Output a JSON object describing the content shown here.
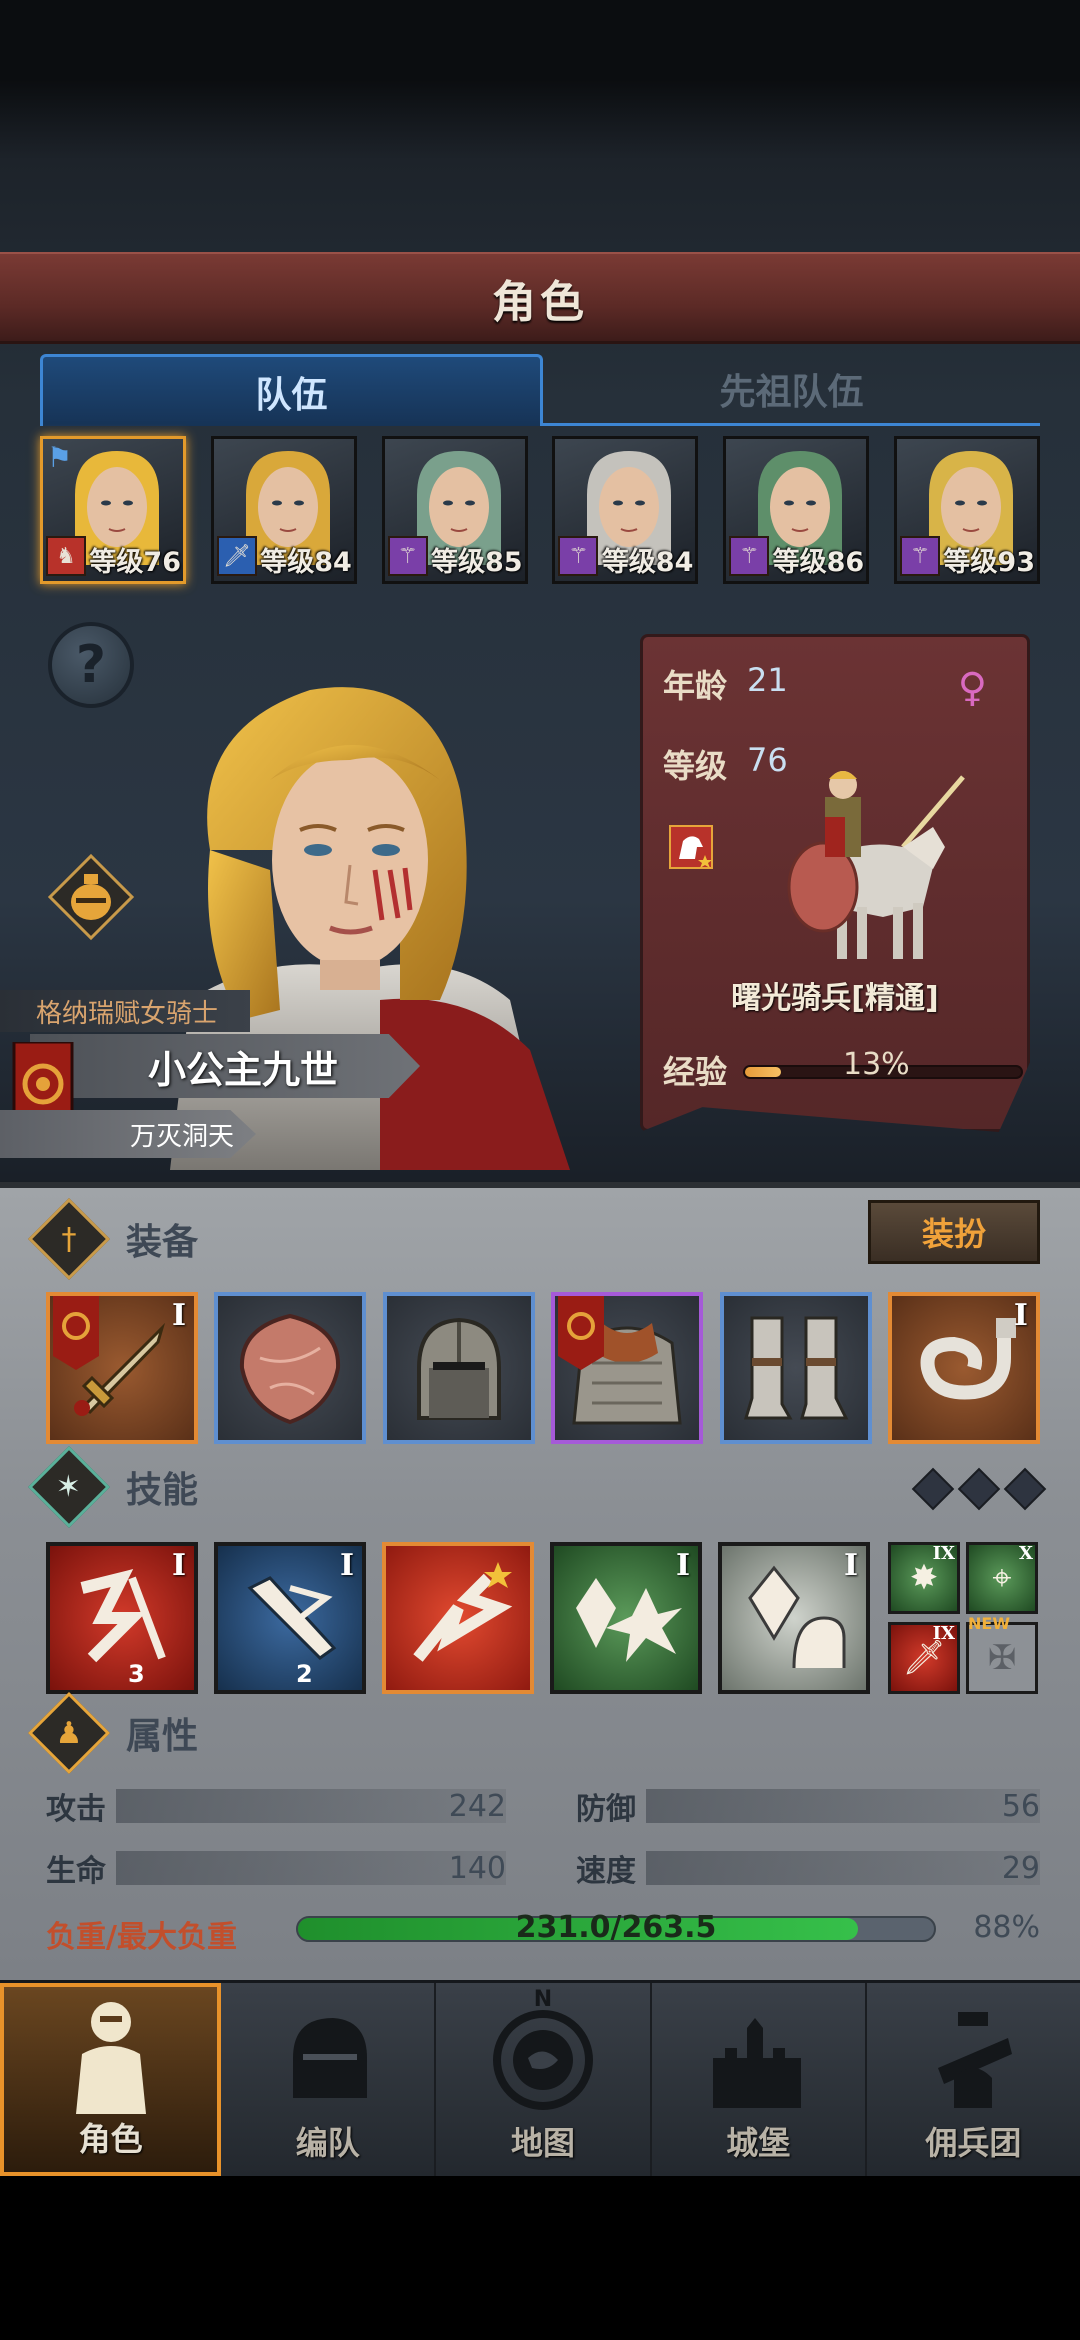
{
  "header": {
    "title": "角色"
  },
  "tabs": [
    {
      "label": "队伍",
      "active": true
    },
    {
      "label": "先祖队伍",
      "active": false
    }
  ],
  "roster": [
    {
      "level": "等级76",
      "class_icon": "horse-icon",
      "class_color": "#b8322a",
      "selected": true
    },
    {
      "level": "等级84",
      "class_icon": "sword-icon",
      "class_color": "#2b5fb0",
      "selected": false
    },
    {
      "level": "等级85",
      "class_icon": "staff-icon",
      "class_color": "#7a3fa8",
      "selected": false
    },
    {
      "level": "等级84",
      "class_icon": "staff-icon",
      "class_color": "#7a3fa8",
      "selected": false
    },
    {
      "level": "等级86",
      "class_icon": "staff-icon",
      "class_color": "#7a3fa8",
      "selected": false
    },
    {
      "level": "等级93",
      "class_icon": "staff-icon",
      "class_color": "#7a3fa8",
      "selected": false
    }
  ],
  "character": {
    "class_name": "格纳瑞赋女骑士",
    "name": "小公主九世",
    "title": "万灭洞天"
  },
  "info": {
    "age_label": "年龄",
    "age": "21",
    "level_label": "等级",
    "level": "76",
    "mount_name": "曙光骑兵[精通]",
    "exp_label": "经验",
    "exp_percent": "13%",
    "exp_fraction": 0.13
  },
  "equipment": {
    "title": "装备",
    "dress_button": "装扮",
    "items": [
      {
        "icon": "sword-icon",
        "tier": "I",
        "rarity": "orange"
      },
      {
        "icon": "shield-icon",
        "tier": "",
        "rarity": "blue"
      },
      {
        "icon": "helmet-icon",
        "tier": "",
        "rarity": "blue"
      },
      {
        "icon": "armor-icon",
        "tier": "",
        "rarity": "purple"
      },
      {
        "icon": "boots-icon",
        "tier": "",
        "rarity": "blue"
      },
      {
        "icon": "horn-icon",
        "tier": "I",
        "rarity": "orange"
      }
    ]
  },
  "skills": {
    "title": "技能",
    "items": [
      {
        "icon": "slash-skill-icon",
        "tier": "I",
        "level": "3",
        "color": "red"
      },
      {
        "icon": "strike-skill-icon",
        "tier": "I",
        "level": "2",
        "color": "blue"
      },
      {
        "icon": "charge-skill-icon",
        "tier": "",
        "level": "",
        "color": "orange"
      },
      {
        "icon": "crystal-burst-skill-icon",
        "tier": "I",
        "level": "",
        "color": "green"
      },
      {
        "icon": "crystal-shield-skill-icon",
        "tier": "I",
        "level": "",
        "color": "white"
      }
    ],
    "passives": [
      {
        "icon": "burst-passive-icon",
        "tier": "IX"
      },
      {
        "icon": "target-passive-icon",
        "tier": "X"
      },
      {
        "icon": "sword-passive-icon",
        "tier": "IX"
      },
      {
        "icon": "cross-passive-icon",
        "tier": ""
      }
    ],
    "new_tag": "NEW"
  },
  "attributes": {
    "title": "属性",
    "attack_label": "攻击",
    "attack": "242",
    "defense_label": "防御",
    "defense": "56",
    "hp_label": "生命",
    "hp": "140",
    "speed_label": "速度",
    "speed": "29",
    "weight_label": "负重/最大负重",
    "weight": "231.0/263.5",
    "weight_percent": "88%",
    "weight_fraction": 0.88
  },
  "nav": [
    {
      "label": "角色",
      "icon": "knight-icon",
      "active": true
    },
    {
      "label": "编队",
      "icon": "helmet-icon",
      "active": false
    },
    {
      "label": "地图",
      "icon": "compass-icon",
      "active": false
    },
    {
      "label": "城堡",
      "icon": "castle-icon",
      "active": false
    },
    {
      "label": "佣兵团",
      "icon": "mercenary-icon",
      "active": false
    }
  ],
  "compass_letter": "N"
}
